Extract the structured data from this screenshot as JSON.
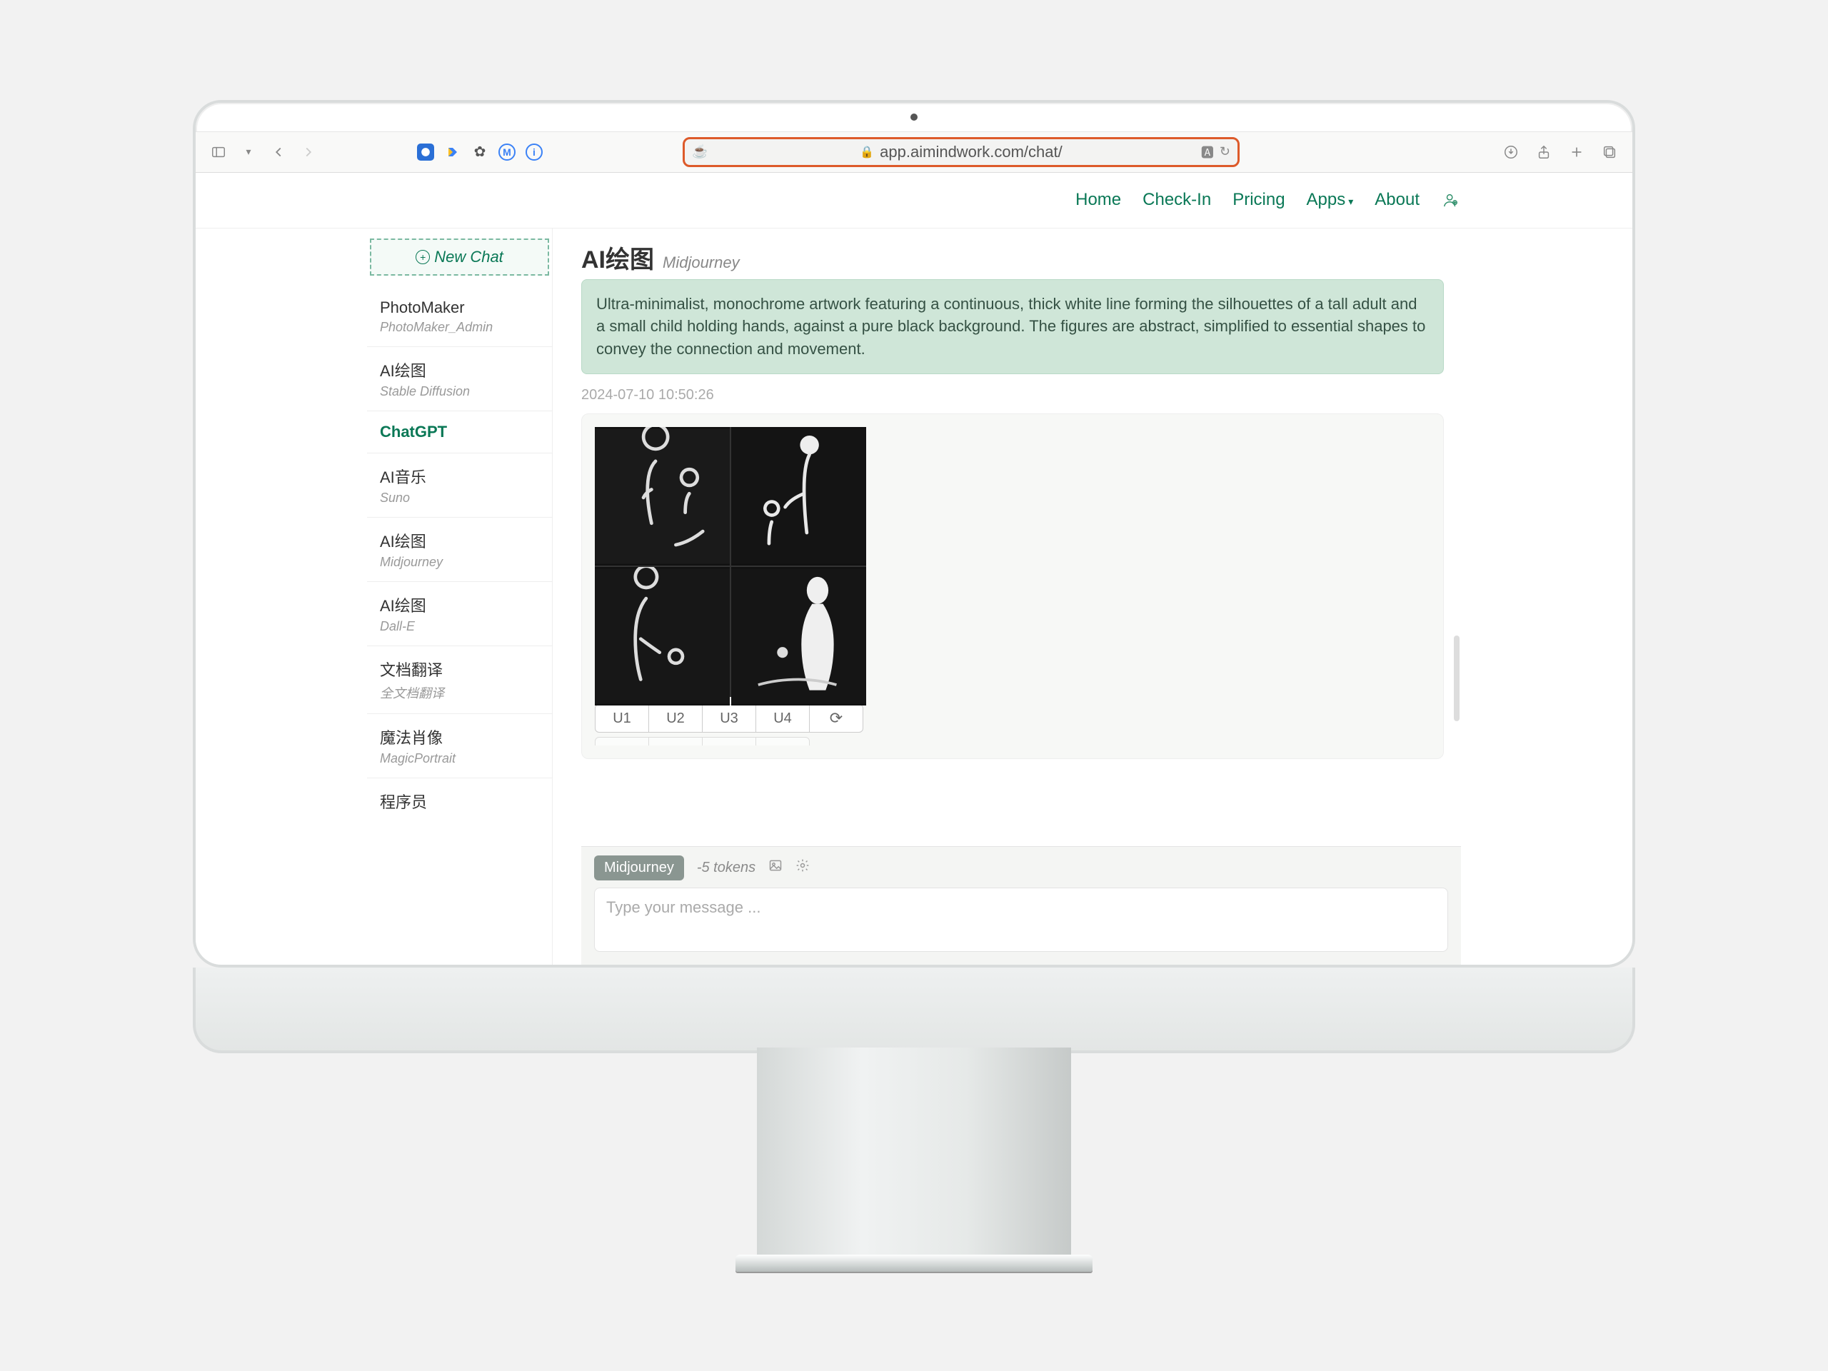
{
  "browser": {
    "url": "app.aimindwork.com/chat/"
  },
  "nav": {
    "items": [
      "Home",
      "Check-In",
      "Pricing",
      "Apps",
      "About"
    ]
  },
  "sidebar": {
    "new_chat": "New Chat",
    "items": [
      {
        "title": "PhotoMaker",
        "sub": "PhotoMaker_Admin"
      },
      {
        "title": "AI绘图",
        "sub": "Stable Diffusion"
      },
      {
        "title": "ChatGPT",
        "sub": ""
      },
      {
        "title": "AI音乐",
        "sub": "Suno"
      },
      {
        "title": "AI绘图",
        "sub": "Midjourney"
      },
      {
        "title": "AI绘图",
        "sub": "Dall-E"
      },
      {
        "title": "文档翻译",
        "sub": "全文档翻译"
      },
      {
        "title": "魔法肖像",
        "sub": "MagicPortrait"
      },
      {
        "title": "程序员",
        "sub": ""
      }
    ],
    "active_index": 2
  },
  "chat": {
    "title": "AI绘图",
    "subtitle": "Midjourney",
    "prompt": "Ultra-minimalist, monochrome artwork featuring a continuous, thick white line forming the silhouettes of a tall adult and a small child holding hands, against a pure black background. The figures are abstract, simplified to essential shapes to convey the connection and movement.",
    "timestamp": "2024-07-10 10:50:26",
    "upscale_buttons": [
      "U1",
      "U2",
      "U3",
      "U4"
    ]
  },
  "input": {
    "model_pill": "Midjourney",
    "tokens": "-5 tokens",
    "placeholder": "Type your message ..."
  }
}
